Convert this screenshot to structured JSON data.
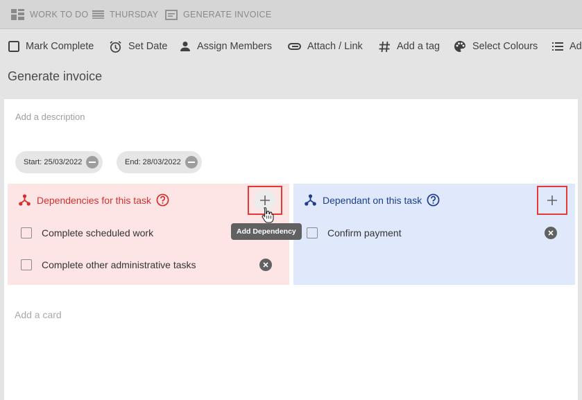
{
  "breadcrumb": {
    "items": [
      {
        "label": "WORK TO DO",
        "icon": "board-icon"
      },
      {
        "label": "THURSDAY",
        "icon": "list-icon"
      },
      {
        "label": "GENERATE INVOICE",
        "icon": "card-icon"
      }
    ]
  },
  "toolbar": {
    "mark_complete": "Mark Complete",
    "set_date": "Set Date",
    "assign_members": "Assign Members",
    "attach_link": "Attach / Link",
    "add_tag": "Add a tag",
    "select_colours": "Select Colours",
    "overflow": "Ad"
  },
  "card": {
    "title": "Generate invoice",
    "description_placeholder": "Add a description",
    "start_date": "Start: 25/03/2022",
    "end_date": "End: 28/03/2022"
  },
  "dependencies": {
    "title": "Dependencies for this task",
    "color": "#d32f2f",
    "items": [
      "Complete scheduled work",
      "Complete other administrative tasks"
    ],
    "add_tooltip": "Add Dependency"
  },
  "dependants": {
    "title": "Dependant on this task",
    "color": "#1a3d8f",
    "items": [
      "Confirm payment"
    ]
  },
  "add_card": "Add a card"
}
